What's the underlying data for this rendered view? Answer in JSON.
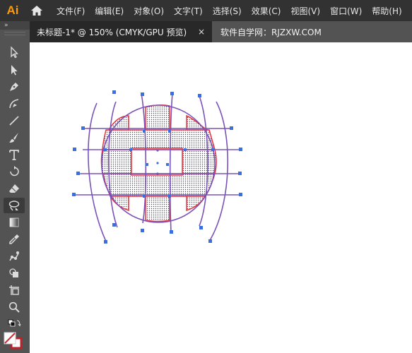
{
  "app": {
    "logo_text": "Ai"
  },
  "menu": {
    "items": [
      {
        "label": "文件(F)"
      },
      {
        "label": "编辑(E)"
      },
      {
        "label": "对象(O)"
      },
      {
        "label": "文字(T)"
      },
      {
        "label": "选择(S)"
      },
      {
        "label": "效果(C)"
      },
      {
        "label": "视图(V)"
      },
      {
        "label": "窗口(W)"
      },
      {
        "label": "帮助(H)"
      }
    ]
  },
  "tabs": {
    "active": {
      "label": "未标题-1* @ 150% (CMYK/GPU 预览)",
      "close": "×"
    },
    "other": {
      "label": "软件自学网：RJZXW.COM"
    }
  },
  "toolbar": {
    "collapse_glyph": "»",
    "tools": [
      {
        "name": "selection-tool",
        "icon": "selection-arrow-icon"
      },
      {
        "name": "direct-selection-tool",
        "icon": "direct-selection-icon"
      },
      {
        "name": "pen-tool",
        "icon": "pen-icon"
      },
      {
        "name": "curvature-tool",
        "icon": "curvature-icon"
      },
      {
        "name": "line-tool",
        "icon": "line-icon"
      },
      {
        "name": "paintbrush-tool",
        "icon": "paintbrush-icon"
      },
      {
        "name": "type-tool",
        "icon": "type-icon"
      },
      {
        "name": "rotate-tool",
        "icon": "rotate-icon"
      },
      {
        "name": "eraser-tool",
        "icon": "eraser-icon"
      },
      {
        "name": "lasso-tool",
        "icon": "lasso-icon"
      },
      {
        "name": "gradient-tool",
        "icon": "gradient-icon"
      },
      {
        "name": "eyedropper-tool",
        "icon": "eyedropper-icon"
      },
      {
        "name": "puppet-warp-tool",
        "icon": "puppet-warp-icon"
      },
      {
        "name": "shape-builder-tool",
        "icon": "shape-builder-icon"
      },
      {
        "name": "artboard-tool",
        "icon": "artboard-icon"
      },
      {
        "name": "zoom-tool",
        "icon": "zoom-icon"
      },
      {
        "name": "default-fill-stroke",
        "icon": "fill-stroke-swap-icon"
      },
      {
        "name": "fill-stroke-swatch",
        "icon": "fill-stroke-icon"
      }
    ]
  },
  "colors": {
    "menubar_bg": "#323232",
    "toolbar_bg": "#535353",
    "active_tab_bg": "#282828",
    "logo": "#ff9a00",
    "envelope_line": "#7a52b8",
    "shape_stroke": "#e8323c",
    "anchor_point": "#3a6fe0"
  }
}
